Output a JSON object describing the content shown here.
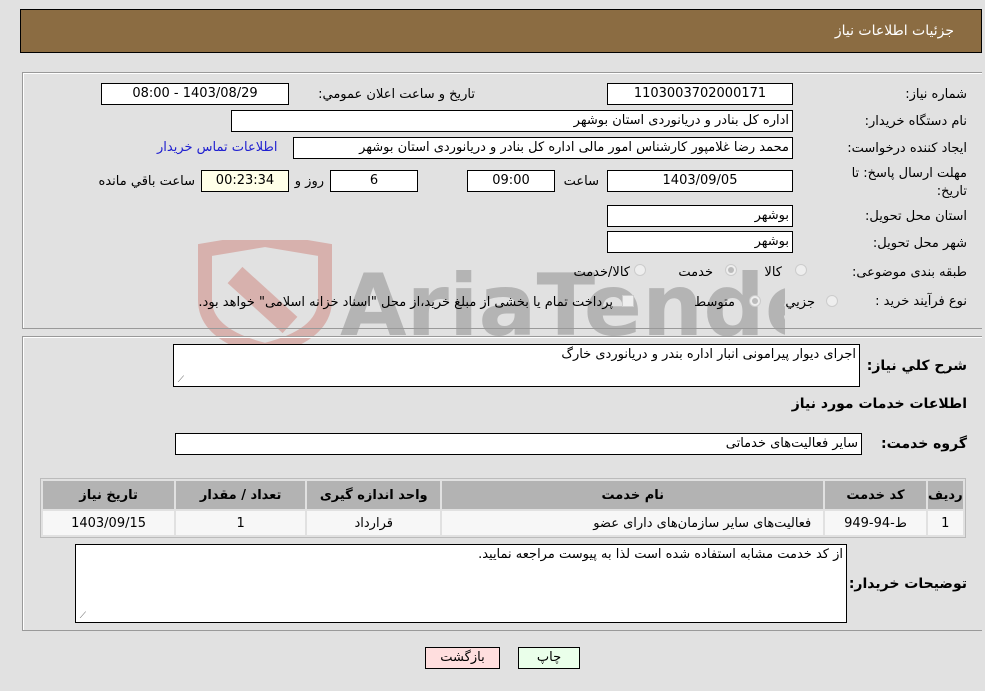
{
  "header": {
    "title": "جزئیات اطلاعات نیاز"
  },
  "form": {
    "need_number": {
      "label": "شماره نیاز:",
      "value": "1103003702000171"
    },
    "announce_datetime": {
      "label": "تاریخ و ساعت اعلان عمومي:",
      "value": "1403/08/29 - 08:00"
    },
    "buyer_org": {
      "label": "نام دستگاه خریدار:",
      "value": "اداره کل بنادر و دریانوردی استان بوشهر"
    },
    "requester": {
      "label": "ایجاد کننده درخواست:",
      "value": "محمد رضا غلامپور کارشناس امور مالی اداره کل بنادر و دریانوردی استان بوشهر",
      "contact_link": "اطلاعات تماس خریدار"
    },
    "deadline": {
      "label_line1": "مهلت ارسال پاسخ: تا",
      "label_line2": "تاریخ:",
      "date": "1403/09/05",
      "time_label": "ساعت",
      "time": "09:00",
      "days": "6",
      "days_label": "روز و",
      "remaining": "00:23:34",
      "remaining_label": "ساعت باقي مانده"
    },
    "delivery_province": {
      "label": "استان محل تحویل:",
      "value": "بوشهر"
    },
    "delivery_city": {
      "label": "شهر محل تحویل:",
      "value": "بوشهر"
    },
    "category": {
      "label": "طبقه بندی موضوعی:",
      "options": [
        {
          "label": "کالا",
          "checked": false
        },
        {
          "label": "خدمت",
          "checked": true
        },
        {
          "label": "کالا/خدمت",
          "checked": false
        }
      ]
    },
    "purchase_type": {
      "label": "نوع فرآیند خرید :",
      "options": [
        {
          "label": "جزيي",
          "checked": false
        },
        {
          "label": "متوسط",
          "checked": true
        }
      ],
      "treasury_note": "پرداخت تمام یا بخشی از مبلغ خرید،از محل \"اسناد خزانه اسلامی\" خواهد بود."
    }
  },
  "details": {
    "description": {
      "label": "شرح کلي نیاز:",
      "value": "اجرای دیوار پیرامونی انبار اداره بندر و دریانوردی خارگ"
    },
    "services_title": "اطلاعات خدمات مورد نیاز",
    "service_group": {
      "label": "گروه خدمت:",
      "value": "سایر فعالیت‌های خدماتی"
    },
    "table": {
      "headers": [
        "ردیف",
        "کد خدمت",
        "نام خدمت",
        "واحد اندازه گیری",
        "تعداد / مقدار",
        "تاریخ نیاز"
      ],
      "rows": [
        [
          "1",
          "ط-94-949",
          "فعالیت‌های سایر سازمان‌های دارای عضو",
          "قرارداد",
          "1",
          "1403/09/15"
        ]
      ]
    },
    "buyer_notes": {
      "label": "توضیحات خریدار:",
      "value": "از کد خدمت مشابه استفاده شده است لذا به پیوست مراجعه نمایید."
    }
  },
  "buttons": {
    "print": "چاپ",
    "back": "بازگشت"
  },
  "watermark": {
    "text": "AriaTender.neT"
  }
}
